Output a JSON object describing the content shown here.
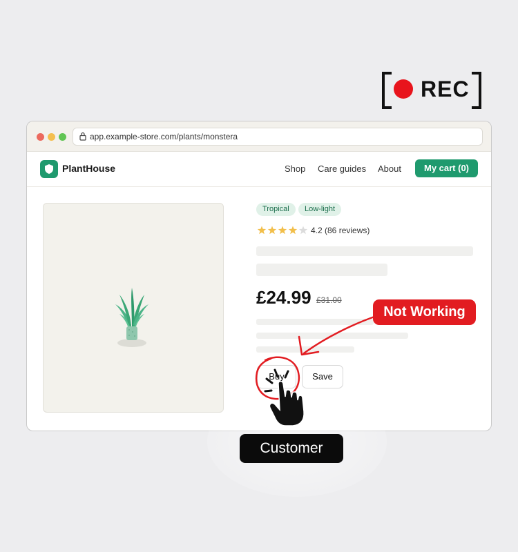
{
  "recording": {
    "label": "REC",
    "accent": "#e8141c"
  },
  "browser": {
    "url": "app.example-store.com/plants/monstera"
  },
  "store": {
    "brand": "PlantHouse",
    "brand_color": "#1f9a6e",
    "nav": [
      {
        "label": "Shop"
      },
      {
        "label": "Care guides"
      },
      {
        "label": "About"
      }
    ],
    "cart_label": "My cart (0)"
  },
  "product": {
    "tags": [
      "Tropical",
      "Low-light"
    ],
    "rating": {
      "stars": 4,
      "max": 5,
      "text": "4.2 (86 reviews)"
    },
    "price": "£24.99",
    "old_price": "£31.00",
    "buy_label": "Buy",
    "save_label": "Save"
  },
  "annotations": {
    "issue_label": "Not Working",
    "issue_color": "#e21c21",
    "user_label": "Customer"
  }
}
